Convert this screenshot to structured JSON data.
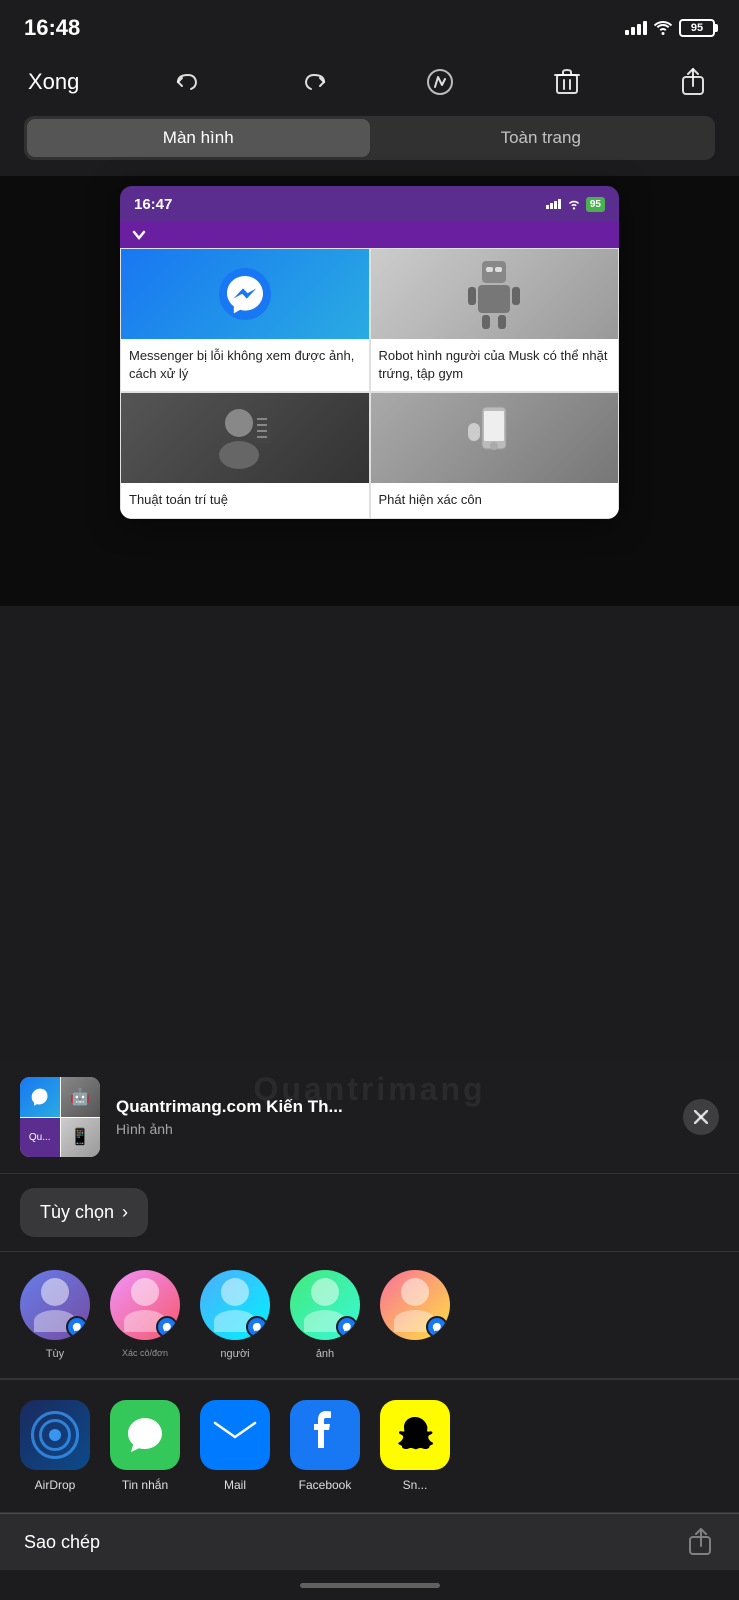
{
  "statusBar": {
    "time": "16:48",
    "battery": "95",
    "batteryColor": "#4CAF50"
  },
  "toolbar": {
    "doneLabel": "Xong",
    "segmentOptions": [
      "Màn hình",
      "Toàn trang"
    ],
    "activeSegment": 0
  },
  "screenshotPreview": {
    "ssTime": "16:47",
    "ssBattery": "95",
    "cards": [
      {
        "title": "Messenger bị lỗi không xem được ảnh, cách xử lý"
      },
      {
        "title": "Robot hình người của Musk có thể nhặt trứng, tập gym"
      },
      {
        "title": "Thuật toán trí tuệ"
      },
      {
        "title": "Phát hiện xác côn"
      }
    ],
    "watermark": "Quantrimang"
  },
  "shareSheet": {
    "title": "Quantrimang.com Kiến Th...",
    "subtitle": "Hình ảnh",
    "optionsLabel": "Tùy chọn",
    "optionsChevron": ">",
    "contacts": [
      {
        "name": "Tùy",
        "hasMessenger": true
      },
      {
        "name": "...",
        "hasMessenger": true
      },
      {
        "name": "Xác cô/đơn",
        "hasMessenger": true
      },
      {
        "name": "người",
        "hasMessenger": true
      },
      {
        "name": "ảnh",
        "hasMessenger": true
      }
    ],
    "apps": [
      {
        "name": "AirDrop",
        "type": "airdrop"
      },
      {
        "name": "Tin nhắn",
        "type": "message"
      },
      {
        "name": "Mail",
        "type": "mail"
      },
      {
        "name": "Facebook",
        "type": "facebook"
      },
      {
        "name": "Sn...",
        "type": "snap"
      }
    ]
  },
  "bottomAction": {
    "label": "Sao chép"
  }
}
